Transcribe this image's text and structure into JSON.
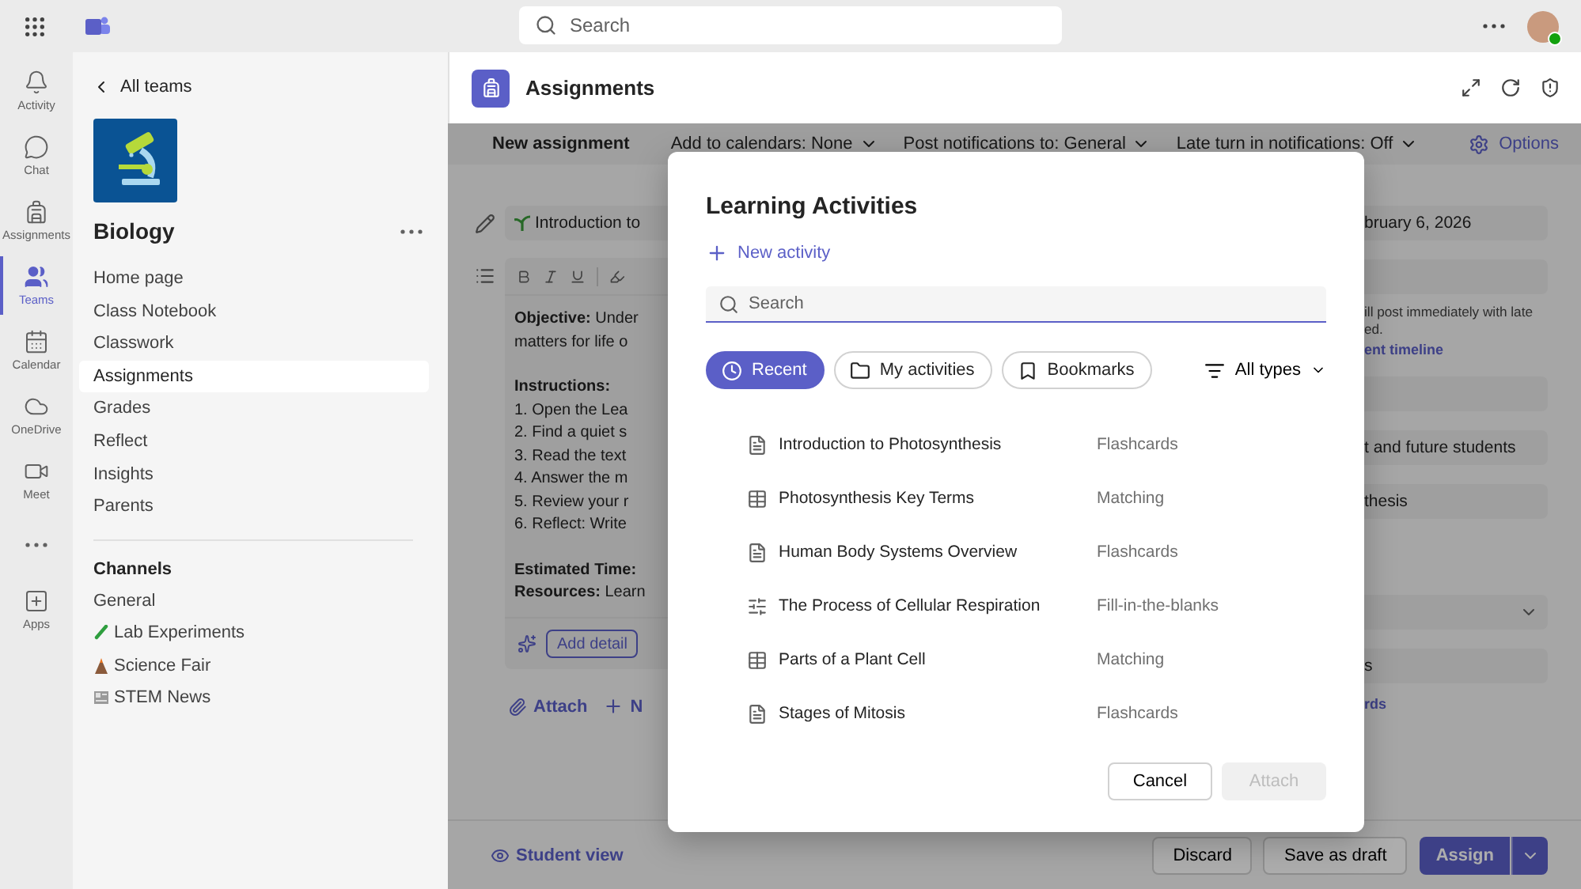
{
  "top_bar": {
    "search_placeholder": "Search"
  },
  "rail": [
    {
      "kind": "bell",
      "label": "Activity",
      "selected": false
    },
    {
      "kind": "chat",
      "label": "Chat",
      "selected": false
    },
    {
      "kind": "backpack",
      "label": "Assignments",
      "selected": false
    },
    {
      "kind": "people",
      "label": "Teams",
      "selected": true
    },
    {
      "kind": "calendar",
      "label": "Calendar",
      "selected": false
    },
    {
      "kind": "cloud",
      "label": "OneDrive",
      "selected": false
    },
    {
      "kind": "video",
      "label": "Meet",
      "selected": false
    },
    {
      "kind": "more",
      "selected": false
    },
    {
      "kind": "apps",
      "label": "Apps",
      "selected": false
    }
  ],
  "team": {
    "back": "All teams",
    "name": "Biology",
    "nav": [
      {
        "label": "Home page",
        "selected": false
      },
      {
        "label": "Class Notebook",
        "selected": false
      },
      {
        "label": "Classwork",
        "selected": false
      },
      {
        "label": "Assignments",
        "selected": true
      },
      {
        "label": "Grades",
        "selected": false
      },
      {
        "label": "Reflect",
        "selected": false
      },
      {
        "label": "Insights",
        "selected": false
      },
      {
        "label": "Parents",
        "selected": false
      }
    ],
    "channels_heading": "Channels",
    "channels": [
      {
        "label": "General",
        "kind": "plain"
      },
      {
        "label": "Lab Experiments",
        "kind": "test-tube"
      },
      {
        "label": "Science Fair",
        "kind": "volcano"
      },
      {
        "label": "STEM News",
        "kind": "newspaper"
      }
    ]
  },
  "app": {
    "title": "Assignments",
    "toolbar": [
      {
        "label": "New assignment",
        "kind": "action"
      },
      {
        "label": "Add to calendars: None",
        "kind": "dropdown"
      },
      {
        "label": "Post notifications to: General",
        "kind": "dropdown"
      },
      {
        "label": "Late turn in notifications: Off",
        "kind": "dropdown"
      }
    ],
    "options": "Options"
  },
  "form": {
    "title_value": "Introduction to",
    "editor": [
      [
        "**Objective:** Under",
        "matters for life o"
      ],
      [
        "**Instructions:**",
        "1. Open the Lea",
        "2. Find a quiet s",
        "3. Read the text",
        "4. Answer the m",
        "5. Review your r",
        "6. Reflect: Write"
      ],
      [
        "**Estimated Time:**",
        "**Resources:** Learn"
      ]
    ],
    "add_detail": "Add detail",
    "attach": "Attach",
    "new": "N",
    "right": [
      {
        "kind": "field",
        "text": "bruary 6, 2026"
      },
      {
        "kind": "field"
      },
      {
        "kind": "note",
        "text": "ill post immediately with late"
      },
      {
        "kind": "note",
        "text": "ed."
      },
      {
        "kind": "link",
        "text": "ent timeline"
      },
      {
        "kind": "field"
      },
      {
        "kind": "field",
        "text": "t and future students"
      },
      {
        "kind": "field",
        "text": "thesis"
      },
      {
        "kind": "gap"
      },
      {
        "kind": "select"
      },
      {
        "kind": "field",
        "text": "s"
      },
      {
        "kind": "link",
        "text": "rds"
      }
    ]
  },
  "footer": {
    "student_view": "Student view",
    "discard": "Discard",
    "save": "Save as draft",
    "assign": "Assign"
  },
  "dialog": {
    "title": "Learning Activities",
    "new_activity": "New activity",
    "search_placeholder": "Search",
    "filters": [
      {
        "label": "Recent",
        "kind": "clock",
        "selected": true
      },
      {
        "label": "My activities",
        "kind": "folder",
        "selected": false
      },
      {
        "label": "Bookmarks",
        "kind": "bookmark",
        "selected": false
      }
    ],
    "type_filter": "All types",
    "activities": [
      {
        "name": "Introduction to Photosynthesis",
        "type": "Flashcards",
        "kind": "flashcards"
      },
      {
        "name": "Photosynthesis Key Terms",
        "type": "Matching",
        "kind": "matching"
      },
      {
        "name": "Human Body Systems Overview",
        "type": "Flashcards",
        "kind": "flashcards"
      },
      {
        "name": "The Process of Cellular Respiration",
        "type": "Fill-in-the-blanks",
        "kind": "fill-blanks"
      },
      {
        "name": "Parts of a Plant Cell",
        "type": "Matching",
        "kind": "matching"
      },
      {
        "name": "Stages of Mitosis",
        "type": "Flashcards",
        "kind": "flashcards"
      }
    ],
    "cancel": "Cancel",
    "attach": {
      "label": "Attach",
      "disabled": true
    }
  }
}
